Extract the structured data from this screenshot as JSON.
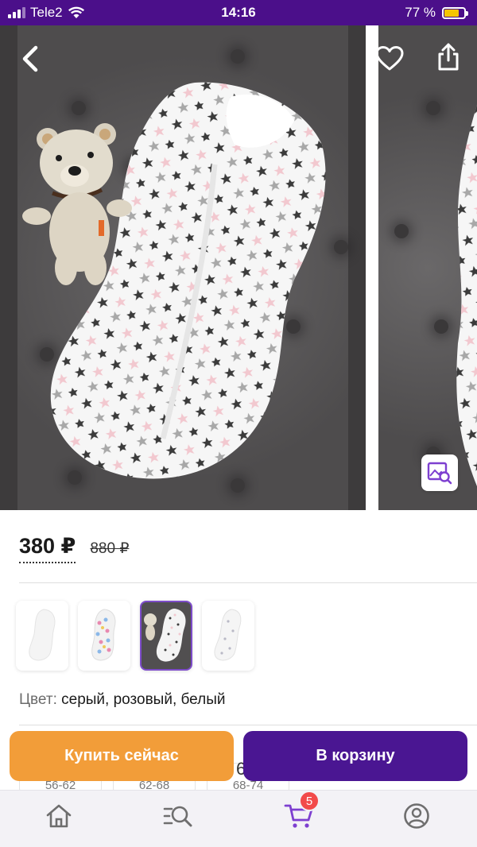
{
  "status_bar": {
    "carrier": "Tele2",
    "time": "14:16",
    "battery": "77 %",
    "battery_level": 0.77,
    "battery_color": "#f5c600",
    "background": "#4b0f8a"
  },
  "gallery": {
    "back_icon": "chevron-left-icon",
    "favorite_icon": "heart-outline-icon",
    "share_icon": "share-icon",
    "search_by_photo_icon": "image-search-icon"
  },
  "price": {
    "current": "380 ₽",
    "old": "880 ₽"
  },
  "thumbnails": [
    {
      "name": "white-sleepsack"
    },
    {
      "name": "pattern-sleepsack"
    },
    {
      "name": "star-sleepsack-with-bear",
      "selected": true
    },
    {
      "name": "white-print-sleepsack"
    }
  ],
  "color": {
    "label": "Цвет:",
    "value": "серый, розовый, белый"
  },
  "sizes": [
    "56-62",
    "62-68",
    "68-74"
  ],
  "sizes_more": "6",
  "actions": {
    "buy_now": "Купить сейчас",
    "add_to_cart": "В корзину",
    "buy_color": "#f29d39",
    "cart_color": "#4a1692"
  },
  "tabbar": {
    "items": [
      {
        "icon": "home-icon"
      },
      {
        "icon": "catalog-search-icon"
      },
      {
        "icon": "cart-icon",
        "badge": "5",
        "active": true
      },
      {
        "icon": "profile-icon"
      }
    ],
    "accent": "#7d3fd0"
  }
}
